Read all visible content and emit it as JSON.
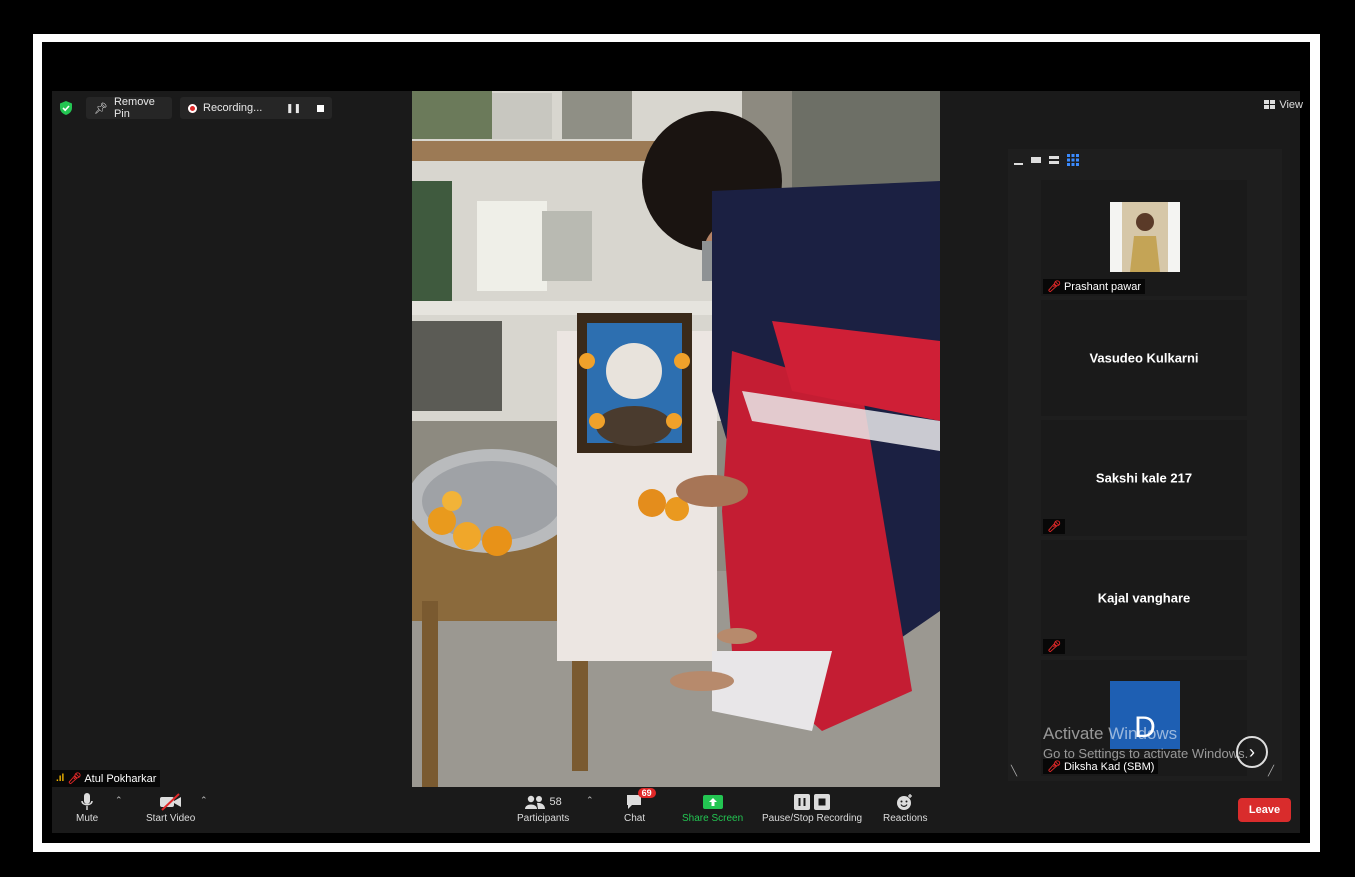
{
  "topbar": {
    "remove_pin_label": "Remove Pin",
    "recording_label": "Recording...",
    "view_label": "View"
  },
  "speaker": {
    "name": "Atul Pokharkar"
  },
  "gallery": {
    "tiles": [
      {
        "name": "Prashant pawar",
        "has_video": true
      },
      {
        "name": "Vasudeo Kulkarni",
        "has_video": false
      },
      {
        "name": "Sakshi  kale  217",
        "has_video": false
      },
      {
        "name": "Kajal vanghare",
        "has_video": false
      },
      {
        "name": "Diksha Kad (SBM)",
        "avatar_letter": "D",
        "avatar_color": "#1e5fb3"
      }
    ]
  },
  "toolbar": {
    "mute_label": "Mute",
    "start_video_label": "Start Video",
    "participants_label": "Participants",
    "participants_count": "58",
    "chat_label": "Chat",
    "chat_badge": "69",
    "share_screen_label": "Share Screen",
    "pause_stop_label": "Pause/Stop Recording",
    "reactions_label": "Reactions",
    "leave_label": "Leave"
  },
  "watermark": {
    "line1": "Activate Windows",
    "line2": "Go to Settings to activate Windows."
  },
  "colors": {
    "share_green": "#23c552",
    "leave_red": "#d92c2c",
    "mic_off_red": "#e02828"
  }
}
